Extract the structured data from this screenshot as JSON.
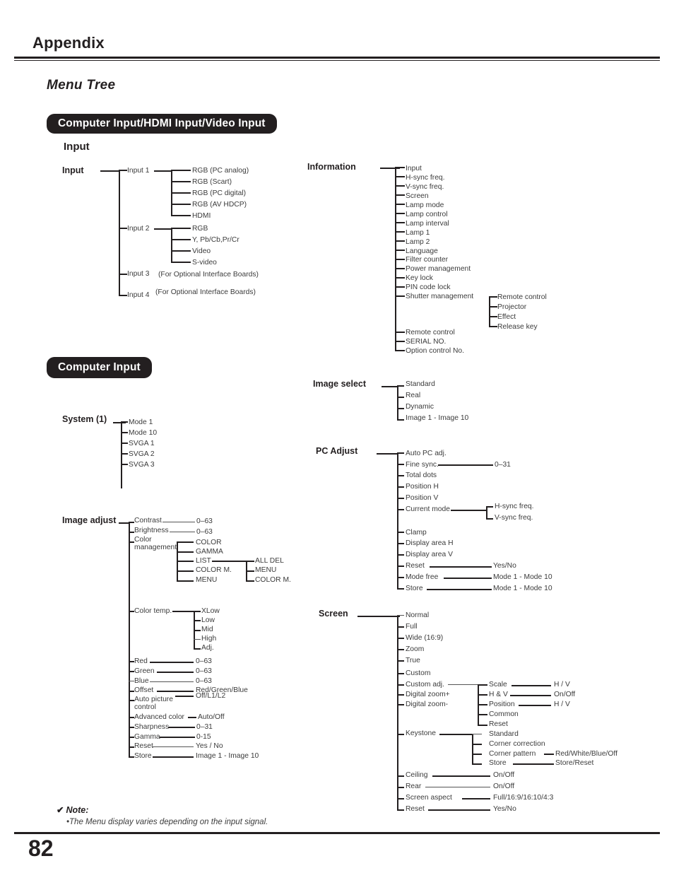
{
  "page": {
    "header_title": "Appendix",
    "section_title": "Menu Tree",
    "page_number": "82"
  },
  "banners": {
    "main": "Computer Input/HDMI Input/Video Input",
    "computer_input": "Computer Input"
  },
  "labels": {
    "input_group": "Input"
  },
  "note": {
    "check": "✔",
    "heading": "Note:",
    "text": "•The Menu display varies depending on the input signal."
  },
  "trees": {
    "input": {
      "root": "Input",
      "children": [
        {
          "label": "Input 1",
          "children": [
            "RGB (PC analog)",
            "RGB (Scart)",
            "RGB (PC digital)",
            "RGB (AV HDCP)",
            "HDMI"
          ]
        },
        {
          "label": "Input 2",
          "children": [
            "RGB",
            "Y, Pb/Cb,Pr/Cr",
            "Video",
            "S-video"
          ]
        },
        {
          "label": "Input 3",
          "note": "(For Optional Interface Boards)",
          "children": []
        },
        {
          "label": "Input 4",
          "note": "(For Optional Interface Boards)",
          "children": []
        }
      ]
    },
    "information": {
      "root": "Information",
      "items": [
        "Input",
        "H-sync freq.",
        "V-sync freq.",
        "Screen",
        "Lamp mode",
        "Lamp control",
        "Lamp interval",
        "Lamp 1",
        "Lamp 2",
        "Language",
        "Filter counter",
        "Power management",
        "Key lock",
        "PIN code lock",
        "Shutter management",
        "Remote control",
        "SERIAL NO.",
        "Option control No."
      ],
      "shutter_children": [
        "Remote control",
        "Projector",
        "Effect",
        "Release key"
      ]
    },
    "system1": {
      "root": "System (1)",
      "items": [
        "Mode 1",
        "Mode 10",
        "SVGA 1",
        "SVGA 2",
        "SVGA 3"
      ]
    },
    "image_select": {
      "root": "Image select",
      "items": [
        "Standard",
        "Real",
        "Dynamic",
        "Image 1 - Image 10"
      ]
    },
    "image_adjust": {
      "root": "Image adjust",
      "rows": [
        {
          "label": "Contrast",
          "value": "0–63"
        },
        {
          "label": "Brightness",
          "value": "0–63"
        },
        {
          "label": "Color management",
          "value": ""
        },
        {
          "label": "Color temp.",
          "value": ""
        },
        {
          "label": "Red",
          "value": "0–63"
        },
        {
          "label": "Green",
          "value": "0–63"
        },
        {
          "label": "Blue",
          "value": "0–63"
        },
        {
          "label": "Offset",
          "value": "Red/Green/Blue"
        },
        {
          "label": "Auto picture control",
          "value": "Off/L1/L2"
        },
        {
          "label": "Advanced color",
          "value": "Auto/Off"
        },
        {
          "label": "Sharpness",
          "value": "0–31"
        },
        {
          "label": "Gamma",
          "value": "0-15"
        },
        {
          "label": "Reset",
          "value": "Yes / No"
        },
        {
          "label": "Store",
          "value": "Image 1 - Image 10"
        }
      ],
      "color_management": [
        "COLOR",
        "GAMMA",
        "LIST",
        "COLOR M.",
        "MENU"
      ],
      "list_children": [
        "ALL DEL",
        "MENU",
        "COLOR M."
      ],
      "color_temp": [
        "XLow",
        "Low",
        "Mid",
        "High",
        "Adj."
      ]
    },
    "pc_adjust": {
      "root": "PC Adjust",
      "rows": [
        {
          "label": "Auto PC adj.",
          "value": ""
        },
        {
          "label": "Fine sync.",
          "value": "0–31"
        },
        {
          "label": "Total dots",
          "value": ""
        },
        {
          "label": "Position H",
          "value": ""
        },
        {
          "label": "Position V",
          "value": ""
        },
        {
          "label": "Current mode",
          "value": ""
        },
        {
          "label": "Clamp",
          "value": ""
        },
        {
          "label": "Display area H",
          "value": ""
        },
        {
          "label": "Display area V",
          "value": ""
        },
        {
          "label": "Reset",
          "value": "Yes/No"
        },
        {
          "label": "Mode free",
          "value": "Mode 1 - Mode 10"
        },
        {
          "label": "Store",
          "value": "Mode 1 - Mode 10"
        }
      ],
      "current_mode_children": [
        "H-sync freq.",
        "V-sync freq."
      ]
    },
    "screen": {
      "root": "Screen",
      "rows": [
        {
          "label": "Normal",
          "value": ""
        },
        {
          "label": "Full",
          "value": ""
        },
        {
          "label": "Wide (16:9)",
          "value": ""
        },
        {
          "label": "Zoom",
          "value": ""
        },
        {
          "label": "True",
          "value": ""
        },
        {
          "label": "Custom",
          "value": ""
        },
        {
          "label": "Custom adj.",
          "value": ""
        },
        {
          "label": "Digital zoom+",
          "value": ""
        },
        {
          "label": "Digital zoom-",
          "value": ""
        },
        {
          "label": "Keystone",
          "value": ""
        },
        {
          "label": "Ceiling",
          "value": "On/Off"
        },
        {
          "label": "Rear",
          "value": "On/Off"
        },
        {
          "label": "Screen aspect",
          "value": "Full/16:9/16:10/4:3"
        },
        {
          "label": "Reset",
          "value": "Yes/No"
        }
      ],
      "custom_adj": [
        {
          "label": "Scale",
          "value": "H / V"
        },
        {
          "label": "H & V",
          "value": "On/Off"
        },
        {
          "label": "Position",
          "value": "H / V"
        },
        {
          "label": "Common",
          "value": ""
        },
        {
          "label": "Reset",
          "value": ""
        }
      ],
      "keystone": [
        {
          "label": "Standard",
          "value": ""
        },
        {
          "label": "Corner correction",
          "value": ""
        },
        {
          "label": "Corner pattern",
          "value": "Red/White/Blue/Off"
        },
        {
          "label": "Store",
          "value": "Store/Reset"
        }
      ]
    }
  }
}
